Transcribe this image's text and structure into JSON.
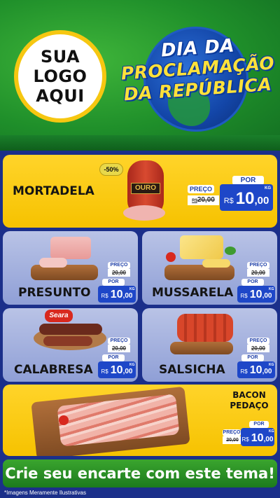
{
  "header": {
    "logo_line1": "SUA",
    "logo_line2": "LOGO",
    "logo_line3": "AQUI",
    "title_line1": "DIA DA",
    "title_line2": "PROCLAMAÇÃO",
    "title_line3": "DA REPÚBLICA"
  },
  "labels": {
    "preco": "PREÇO",
    "por": "POR",
    "currency": "R$",
    "unit": "KG"
  },
  "products": [
    {
      "name": "MORTADELA",
      "old_price": "20,00",
      "price_int": "10",
      "price_dec": ",00",
      "discount": "-50%",
      "brand": "OURO"
    },
    {
      "name": "PRESUNTO",
      "old_price": "20,00",
      "price_int": "10",
      "price_dec": ",00"
    },
    {
      "name": "MUSSARELA",
      "old_price": "20,00",
      "price_int": "10",
      "price_dec": ",00"
    },
    {
      "name": "CALABRESA",
      "old_price": "20,00",
      "price_int": "10",
      "price_dec": ",00",
      "brand": "Seara"
    },
    {
      "name": "SALSICHA",
      "old_price": "20,00",
      "price_int": "10",
      "price_dec": ",00"
    },
    {
      "name_line1": "BACON",
      "name_line2": "PEDAÇO",
      "old_price": "20,00",
      "price_int": "10",
      "price_dec": ",00"
    }
  ],
  "footer": {
    "cta": "Crie seu encarte com este tema!",
    "disclaimer": "*Imagens Meramente Ilustrativas"
  },
  "colors": {
    "green": "#1f8f2a",
    "yellow": "#f6c200",
    "blue_card": "#8f9fd6",
    "price_blue": "#1e47c8",
    "background": "#1b2f8a"
  }
}
